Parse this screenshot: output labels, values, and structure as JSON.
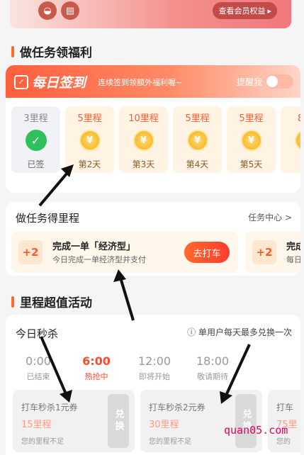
{
  "header": {
    "vip_label": "查看会员权益",
    "vip_arrow": "▸",
    "icon1": "gift-icon",
    "icon2": "voucher-icon"
  },
  "section1": {
    "title": "做任务领福利"
  },
  "signin": {
    "title": "每日签到",
    "calendar_icon": "✓",
    "subtitle": "连续签到领额外福利喔~",
    "remind_label": "提醒我",
    "toggle_on": false,
    "days": [
      {
        "points": "3里程",
        "label": "已签",
        "done": true
      },
      {
        "points": "5里程",
        "label": "第2天",
        "done": false
      },
      {
        "points": "10里程",
        "label": "第3天",
        "done": false
      },
      {
        "points": "5里程",
        "label": "第4天",
        "done": false
      },
      {
        "points": "5里程",
        "label": "第5天",
        "done": false
      },
      {
        "points": "8里",
        "label": "第",
        "done": false
      }
    ],
    "coin_symbol": "¥",
    "check_symbol": "✓"
  },
  "tasks": {
    "title": "做任务得里程",
    "center_label": "任务中心",
    "center_arrow": ">",
    "items": [
      {
        "points": "+2",
        "name": "完成一单「经济型」",
        "desc": "今日完成一单经济型并支付",
        "button": "去打车"
      },
      {
        "points": "+2",
        "name": "完成",
        "desc": "每日"
      }
    ]
  },
  "section2": {
    "title": "里程超值活动"
  },
  "seckill": {
    "title": "今日秒杀",
    "note_icon": "ⓘ",
    "note": "单用户每天最多兑换一次",
    "slots": [
      {
        "time": "0:00",
        "status": "已结束"
      },
      {
        "time": "6:00",
        "status": "热抢中"
      },
      {
        "time": "12:00",
        "status": "即将开始"
      },
      {
        "time": "18:00",
        "status": "敬请期待"
      }
    ],
    "coupons": [
      {
        "name": "打车秒杀1元券",
        "price": "15里程",
        "status": "您的里程不足",
        "button": "兑换"
      },
      {
        "name": "打车秒杀2元券",
        "price": "30里程",
        "status": "您的里程不足",
        "button": "兑换"
      },
      {
        "name": "打车",
        "price": "75里",
        "status": "您的"
      }
    ]
  },
  "watermark": "quan05.com"
}
